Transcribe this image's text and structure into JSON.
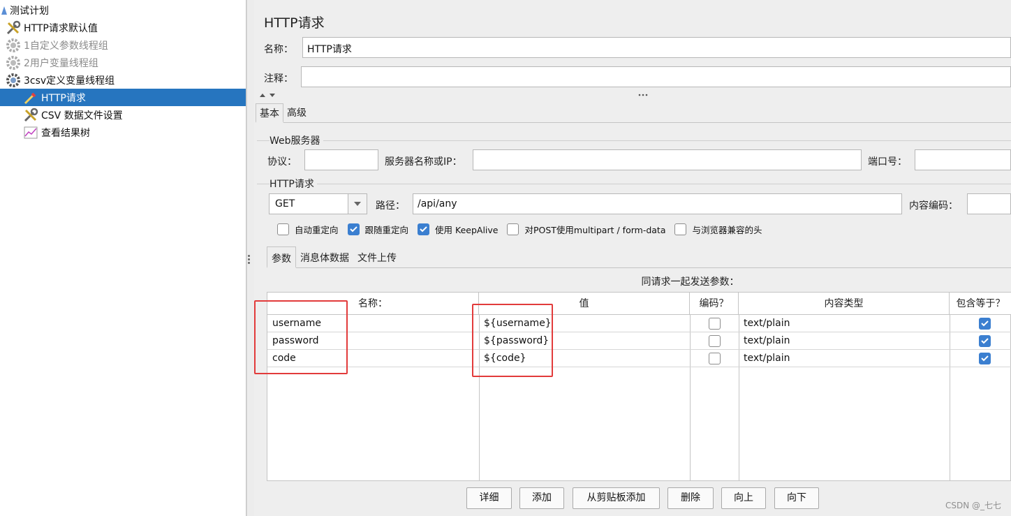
{
  "tree": {
    "items": [
      {
        "label": "测试计划",
        "icon": "test-plan-icon",
        "disabled": false,
        "selected": false
      },
      {
        "label": "HTTP请求默认值",
        "icon": "wrench-icon",
        "disabled": false,
        "selected": false
      },
      {
        "label": "1自定义参数线程组",
        "icon": "gear-icon",
        "disabled": true,
        "selected": false
      },
      {
        "label": "2用户变量线程组",
        "icon": "gear-icon",
        "disabled": true,
        "selected": false
      },
      {
        "label": "3csv定义变量线程组",
        "icon": "gear-icon",
        "disabled": false,
        "selected": false
      },
      {
        "label": "HTTP请求",
        "icon": "pipette-icon",
        "disabled": false,
        "selected": true
      },
      {
        "label": "CSV 数据文件设置",
        "icon": "wrench-icon",
        "disabled": false,
        "selected": false
      },
      {
        "label": "查看结果树",
        "icon": "chart-icon",
        "disabled": false,
        "selected": false
      }
    ]
  },
  "panel": {
    "title": "HTTP请求",
    "name_label": "名称：",
    "name_value": "HTTP请求",
    "comment_label": "注释：",
    "comment_value": "",
    "tabs": [
      "基本",
      "高级"
    ],
    "web_server": {
      "group_title": "Web服务器",
      "protocol_label": "协议：",
      "protocol_value": "",
      "server_label": "服务器名称或IP：",
      "server_value": "",
      "port_label": "端口号：",
      "port_value": ""
    },
    "http_request": {
      "group_title": "HTTP请求",
      "method": "GET",
      "path_label": "路径：",
      "path_value": "/api/any",
      "encoding_label": "内容编码：",
      "encoding_value": ""
    },
    "options": [
      {
        "label": "自动重定向",
        "checked": false
      },
      {
        "label": "跟随重定向",
        "checked": true
      },
      {
        "label": "使用 KeepAlive",
        "checked": true
      },
      {
        "label": "对POST使用multipart / form-data",
        "checked": false
      },
      {
        "label": "与浏览器兼容的头",
        "checked": false
      }
    ],
    "subtabs": [
      "参数",
      "消息体数据",
      "文件上传"
    ],
    "table_caption": "同请求一起发送参数：",
    "table": {
      "columns": [
        "名称：",
        "值",
        "编码？",
        "内容类型",
        "包含等于？"
      ],
      "rows": [
        {
          "name": "username",
          "value": "${username}",
          "encode": false,
          "content_type": "text/plain",
          "include_equals": true
        },
        {
          "name": "password",
          "value": "${password}",
          "encode": false,
          "content_type": "text/plain",
          "include_equals": true
        },
        {
          "name": "code",
          "value": "${code}",
          "encode": false,
          "content_type": "text/plain",
          "include_equals": true
        }
      ]
    },
    "buttons": [
      "详细",
      "添加",
      "从剪贴板添加",
      "删除",
      "向上",
      "向下"
    ]
  },
  "colors": {
    "selection": "#2675bf",
    "highlight": "#e23b3b",
    "checkbox": "#3b7fd0"
  },
  "watermark": "CSDN @_七七"
}
